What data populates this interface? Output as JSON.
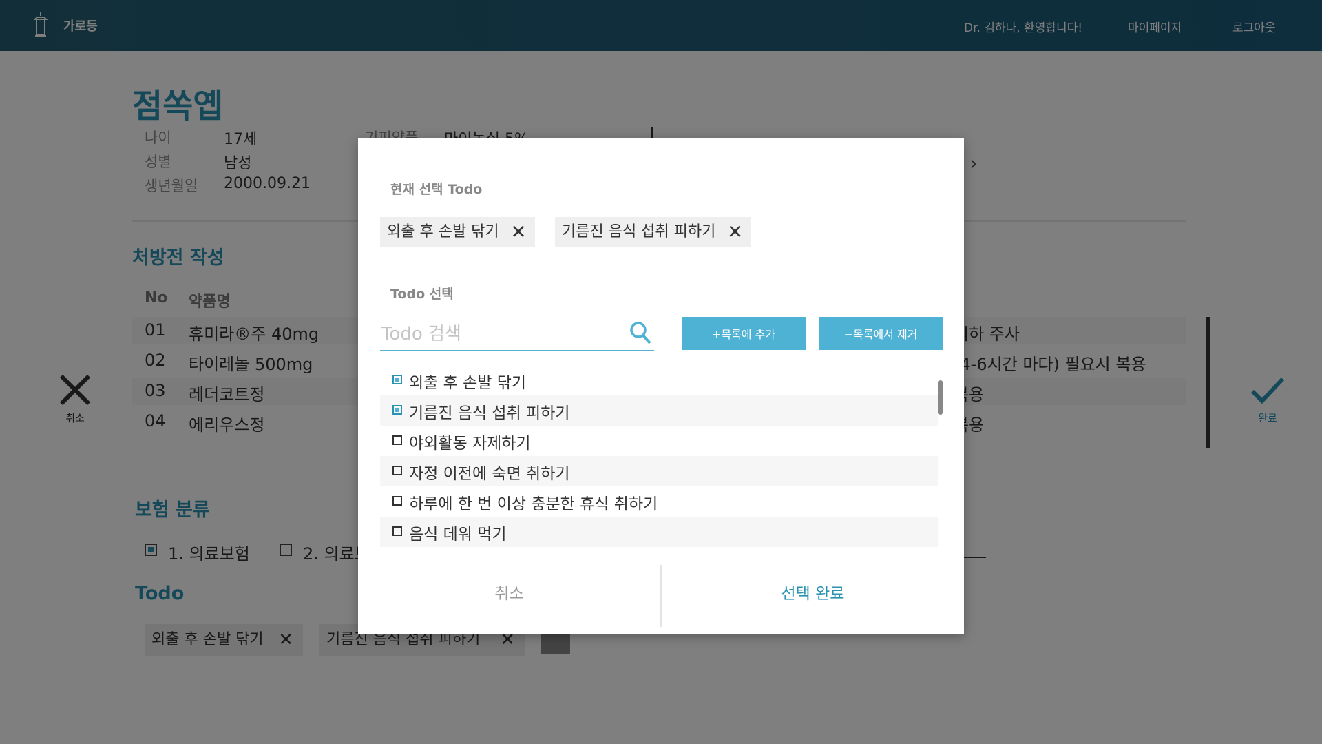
{
  "header": {
    "brand": "가로등",
    "greeting": "Dr. 김하나, 환영합니다!",
    "mypage": "마이페이지",
    "logout": "로그아웃"
  },
  "patient": {
    "name": "점쏙옙",
    "age_label": "나이",
    "age": "17세",
    "sex_label": "성별",
    "sex": "남성",
    "birth_label": "생년월일",
    "birth": "2000.09.21",
    "allergy_label": "기피약품",
    "allergy": "마이녹실 5%"
  },
  "prescription": {
    "title": "처방전 작성",
    "col_no": "No",
    "col_drug": "약품명",
    "rows": [
      {
        "no": "01",
        "drug": "휴미라®주 40mg",
        "note": "피하 주사"
      },
      {
        "no": "02",
        "drug": "타이레놀 500mg",
        "note": "(4-6시간 마다) 필요시 복용"
      },
      {
        "no": "03",
        "drug": "레더코트정",
        "note": "복용"
      },
      {
        "no": "04",
        "drug": "에리우스정",
        "note": "복용"
      }
    ]
  },
  "side": {
    "cancel": "취소",
    "done": "완료"
  },
  "insurance": {
    "title": "보험 분류",
    "opt1": "1. 의료보험",
    "opt2": "2. 의료보"
  },
  "todo_section": {
    "title": "Todo",
    "chips": [
      "외출 후 손발 닦기",
      "기름진 음식 섭취 피하기"
    ]
  },
  "modal": {
    "current_label": "현재 선택 Todo",
    "selected": [
      "외출 후 손발 닦기",
      "기름진 음식 섭취 피하기"
    ],
    "select_label": "Todo 선택",
    "search_placeholder": "Todo 검색",
    "add_button": "+목록에 추가",
    "remove_button": "−목록에서 제거",
    "items": [
      {
        "label": "외출 후 손발 닦기",
        "checked": true
      },
      {
        "label": "기름진 음식 섭취 피하기",
        "checked": true
      },
      {
        "label": "야외활동 자제하기",
        "checked": false
      },
      {
        "label": "자정 이전에 숙면 취하기",
        "checked": false
      },
      {
        "label": "하루에 한 번 이상 충분한 휴식 취하기",
        "checked": false
      },
      {
        "label": "음식 데워 먹기",
        "checked": false
      }
    ],
    "cancel": "취소",
    "confirm": "선택 완료"
  },
  "colors": {
    "header": "#1d5b7a",
    "accent": "#2b93b2",
    "button": "#4db2d4"
  }
}
